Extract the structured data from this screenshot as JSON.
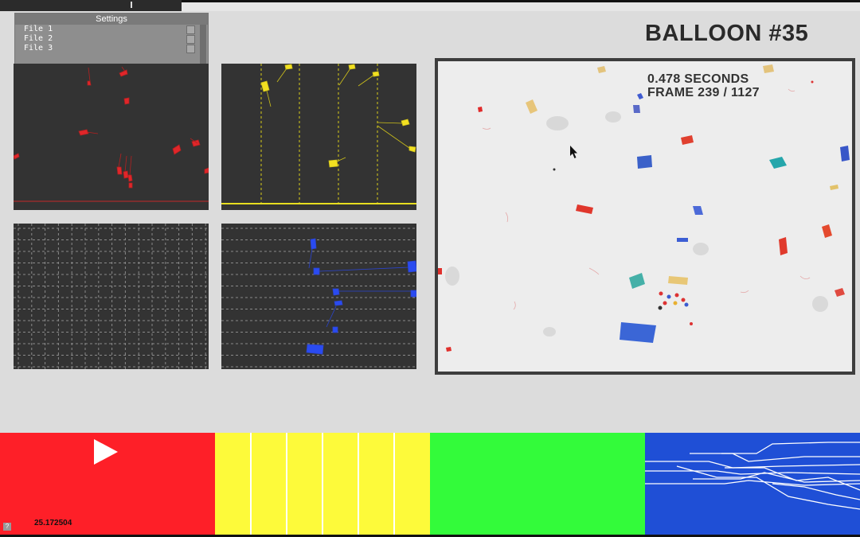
{
  "settings": {
    "title": "Settings",
    "files": [
      "File 1",
      "File 2",
      "File 3"
    ]
  },
  "header": {
    "title": "BALLOON #35"
  },
  "video": {
    "seconds_label": "0.478 SECONDS",
    "frame_label": "FRAME 239 / 1127"
  },
  "player": {
    "timecode": "25.172504",
    "help_label": "?"
  },
  "colors": {
    "red": "#fe1f28",
    "yellow": "#fdfa3a",
    "green": "#33fb3a",
    "blue": "#1f4fd6",
    "panel_bg": "#333333"
  }
}
